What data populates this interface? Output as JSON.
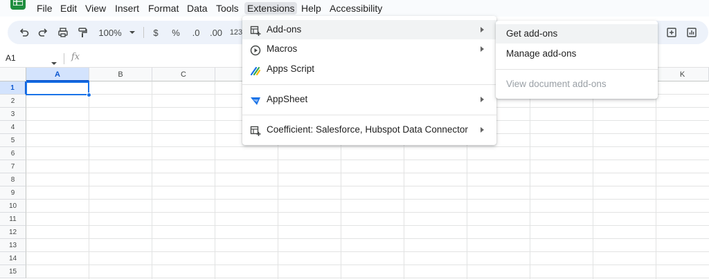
{
  "menubar": {
    "items": [
      "File",
      "Edit",
      "View",
      "Insert",
      "Format",
      "Data",
      "Tools",
      "Extensions",
      "Help",
      "Accessibility"
    ]
  },
  "toolbar": {
    "zoom": "100%",
    "currency": "$",
    "percent": "%",
    "decrease_decimals": ".0",
    "increase_decimals": ".00",
    "more_formats": "123"
  },
  "formula_bar": {
    "name_box": "A1",
    "fx_label": "fx"
  },
  "grid": {
    "columns": [
      "A",
      "B",
      "C",
      "K"
    ],
    "rows": [
      "1",
      "2",
      "3",
      "4",
      "5",
      "6",
      "7",
      "8",
      "9",
      "10",
      "11",
      "12",
      "13",
      "14",
      "15"
    ],
    "selected_cell": "A1"
  },
  "extensions_menu": {
    "items": [
      {
        "label": "Add-ons",
        "icon": "add-ons-icon",
        "has_submenu": true
      },
      {
        "label": "Macros",
        "icon": "macros-icon",
        "has_submenu": true
      },
      {
        "label": "Apps Script",
        "icon": "apps-script-icon",
        "has_submenu": false
      },
      {
        "label": "AppSheet",
        "icon": "appsheet-icon",
        "has_submenu": true
      },
      {
        "label": "Coefficient: Salesforce, Hubspot Data Connector",
        "icon": "coefficient-icon",
        "has_submenu": true
      }
    ]
  },
  "addons_submenu": {
    "items": [
      {
        "label": "Get add-ons",
        "disabled": false
      },
      {
        "label": "Manage add-ons",
        "disabled": false
      },
      {
        "label": "View document add-ons",
        "disabled": true
      }
    ]
  },
  "colors": {
    "accent": "#1a73e8",
    "brand_green": "#1e8e3e",
    "toolbar_bg": "#edf2fa",
    "selected_header": "#d3e3fd"
  }
}
